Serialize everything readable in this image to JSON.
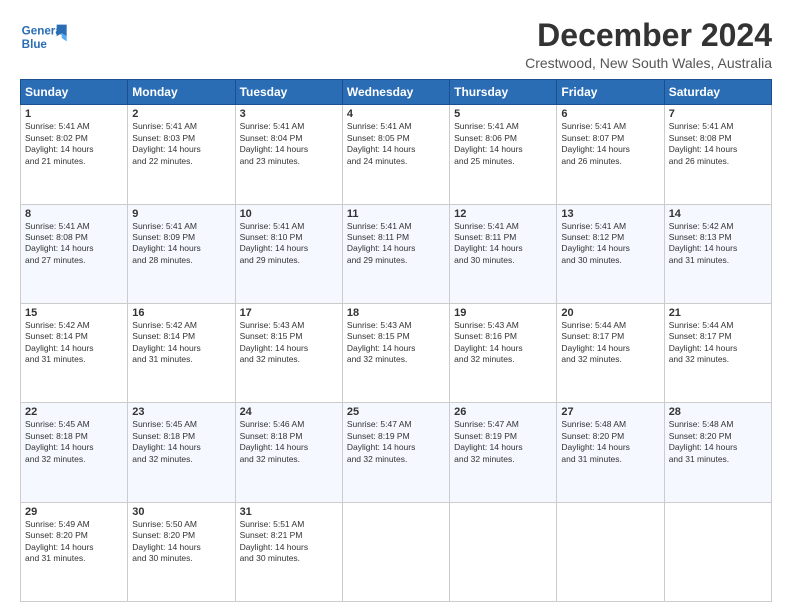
{
  "header": {
    "logo_line1": "General",
    "logo_line2": "Blue",
    "main_title": "December 2024",
    "subtitle": "Crestwood, New South Wales, Australia"
  },
  "columns": [
    "Sunday",
    "Monday",
    "Tuesday",
    "Wednesday",
    "Thursday",
    "Friday",
    "Saturday"
  ],
  "weeks": [
    [
      {
        "day": "1",
        "info": "Sunrise: 5:41 AM\nSunset: 8:02 PM\nDaylight: 14 hours\nand 21 minutes."
      },
      {
        "day": "2",
        "info": "Sunrise: 5:41 AM\nSunset: 8:03 PM\nDaylight: 14 hours\nand 22 minutes."
      },
      {
        "day": "3",
        "info": "Sunrise: 5:41 AM\nSunset: 8:04 PM\nDaylight: 14 hours\nand 23 minutes."
      },
      {
        "day": "4",
        "info": "Sunrise: 5:41 AM\nSunset: 8:05 PM\nDaylight: 14 hours\nand 24 minutes."
      },
      {
        "day": "5",
        "info": "Sunrise: 5:41 AM\nSunset: 8:06 PM\nDaylight: 14 hours\nand 25 minutes."
      },
      {
        "day": "6",
        "info": "Sunrise: 5:41 AM\nSunset: 8:07 PM\nDaylight: 14 hours\nand 26 minutes."
      },
      {
        "day": "7",
        "info": "Sunrise: 5:41 AM\nSunset: 8:08 PM\nDaylight: 14 hours\nand 26 minutes."
      }
    ],
    [
      {
        "day": "8",
        "info": "Sunrise: 5:41 AM\nSunset: 8:08 PM\nDaylight: 14 hours\nand 27 minutes."
      },
      {
        "day": "9",
        "info": "Sunrise: 5:41 AM\nSunset: 8:09 PM\nDaylight: 14 hours\nand 28 minutes."
      },
      {
        "day": "10",
        "info": "Sunrise: 5:41 AM\nSunset: 8:10 PM\nDaylight: 14 hours\nand 29 minutes."
      },
      {
        "day": "11",
        "info": "Sunrise: 5:41 AM\nSunset: 8:11 PM\nDaylight: 14 hours\nand 29 minutes."
      },
      {
        "day": "12",
        "info": "Sunrise: 5:41 AM\nSunset: 8:11 PM\nDaylight: 14 hours\nand 30 minutes."
      },
      {
        "day": "13",
        "info": "Sunrise: 5:41 AM\nSunset: 8:12 PM\nDaylight: 14 hours\nand 30 minutes."
      },
      {
        "day": "14",
        "info": "Sunrise: 5:42 AM\nSunset: 8:13 PM\nDaylight: 14 hours\nand 31 minutes."
      }
    ],
    [
      {
        "day": "15",
        "info": "Sunrise: 5:42 AM\nSunset: 8:14 PM\nDaylight: 14 hours\nand 31 minutes."
      },
      {
        "day": "16",
        "info": "Sunrise: 5:42 AM\nSunset: 8:14 PM\nDaylight: 14 hours\nand 31 minutes."
      },
      {
        "day": "17",
        "info": "Sunrise: 5:43 AM\nSunset: 8:15 PM\nDaylight: 14 hours\nand 32 minutes."
      },
      {
        "day": "18",
        "info": "Sunrise: 5:43 AM\nSunset: 8:15 PM\nDaylight: 14 hours\nand 32 minutes."
      },
      {
        "day": "19",
        "info": "Sunrise: 5:43 AM\nSunset: 8:16 PM\nDaylight: 14 hours\nand 32 minutes."
      },
      {
        "day": "20",
        "info": "Sunrise: 5:44 AM\nSunset: 8:17 PM\nDaylight: 14 hours\nand 32 minutes."
      },
      {
        "day": "21",
        "info": "Sunrise: 5:44 AM\nSunset: 8:17 PM\nDaylight: 14 hours\nand 32 minutes."
      }
    ],
    [
      {
        "day": "22",
        "info": "Sunrise: 5:45 AM\nSunset: 8:18 PM\nDaylight: 14 hours\nand 32 minutes."
      },
      {
        "day": "23",
        "info": "Sunrise: 5:45 AM\nSunset: 8:18 PM\nDaylight: 14 hours\nand 32 minutes."
      },
      {
        "day": "24",
        "info": "Sunrise: 5:46 AM\nSunset: 8:18 PM\nDaylight: 14 hours\nand 32 minutes."
      },
      {
        "day": "25",
        "info": "Sunrise: 5:47 AM\nSunset: 8:19 PM\nDaylight: 14 hours\nand 32 minutes."
      },
      {
        "day": "26",
        "info": "Sunrise: 5:47 AM\nSunset: 8:19 PM\nDaylight: 14 hours\nand 32 minutes."
      },
      {
        "day": "27",
        "info": "Sunrise: 5:48 AM\nSunset: 8:20 PM\nDaylight: 14 hours\nand 31 minutes."
      },
      {
        "day": "28",
        "info": "Sunrise: 5:48 AM\nSunset: 8:20 PM\nDaylight: 14 hours\nand 31 minutes."
      }
    ],
    [
      {
        "day": "29",
        "info": "Sunrise: 5:49 AM\nSunset: 8:20 PM\nDaylight: 14 hours\nand 31 minutes."
      },
      {
        "day": "30",
        "info": "Sunrise: 5:50 AM\nSunset: 8:20 PM\nDaylight: 14 hours\nand 30 minutes."
      },
      {
        "day": "31",
        "info": "Sunrise: 5:51 AM\nSunset: 8:21 PM\nDaylight: 14 hours\nand 30 minutes."
      },
      null,
      null,
      null,
      null
    ]
  ]
}
